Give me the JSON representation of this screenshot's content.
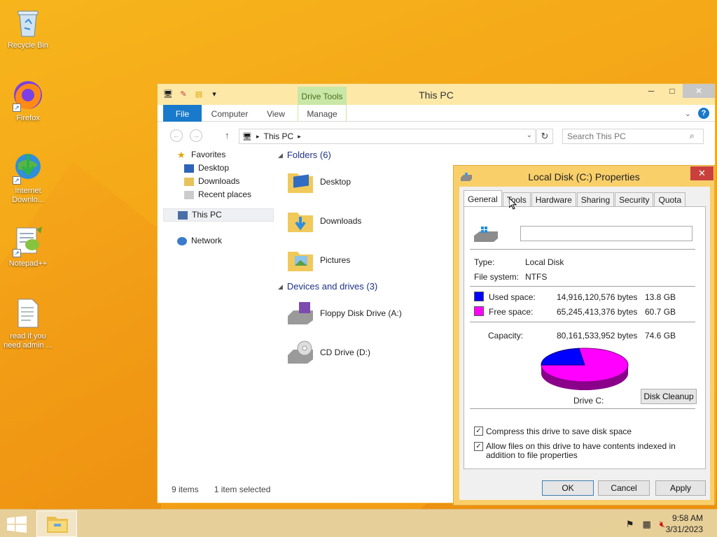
{
  "desktop": {
    "icons": [
      {
        "label": "Recycle Bin"
      },
      {
        "label": "Firefox"
      },
      {
        "label": "Internet Downlo..."
      },
      {
        "label": "Notepad++"
      },
      {
        "label": "read if you need admin ..."
      }
    ]
  },
  "explorer": {
    "title": "This PC",
    "contextual_tab": "Drive Tools",
    "ribbon_tabs": [
      "File",
      "Computer",
      "View",
      "Manage"
    ],
    "address": "This PC",
    "search_placeholder": "Search This PC",
    "nav": {
      "favorites": "Favorites",
      "fav_items": [
        "Desktop",
        "Downloads",
        "Recent places"
      ],
      "this_pc": "This PC",
      "network": "Network"
    },
    "folders_header": "Folders (6)",
    "folders": [
      "Desktop",
      "Downloads",
      "Pictures"
    ],
    "devices_header": "Devices and drives (3)",
    "devices": [
      "Floppy Disk Drive (A:)",
      "CD Drive (D:)"
    ],
    "status": {
      "items": "9 items",
      "selected": "1 item selected"
    }
  },
  "properties": {
    "title": "Local Disk (C:) Properties",
    "tabs": [
      "General",
      "Tools",
      "Hardware",
      "Sharing",
      "Security",
      "Quota"
    ],
    "active_tab": "General",
    "name_value": "",
    "type_label": "Type:",
    "type_value": "Local Disk",
    "fs_label": "File system:",
    "fs_value": "NTFS",
    "used_label": "Used space:",
    "used_bytes": "14,916,120,576 bytes",
    "used_gb": "13.8 GB",
    "free_label": "Free space:",
    "free_bytes": "65,245,413,376 bytes",
    "free_gb": "60.7 GB",
    "cap_label": "Capacity:",
    "cap_bytes": "80,161,533,952 bytes",
    "cap_gb": "74.6 GB",
    "drive_label": "Drive C:",
    "disk_cleanup": "Disk Cleanup",
    "compress_label": "Compress this drive to save disk space",
    "compress_checked": true,
    "index_label": "Allow files on this drive to have contents indexed in addition to file properties",
    "index_checked": true,
    "ok": "OK",
    "cancel": "Cancel",
    "apply": "Apply",
    "colors": {
      "used": "#0000ff",
      "free": "#ff00ff"
    }
  },
  "taskbar": {
    "time": "9:58 AM",
    "date": "3/31/2023"
  }
}
